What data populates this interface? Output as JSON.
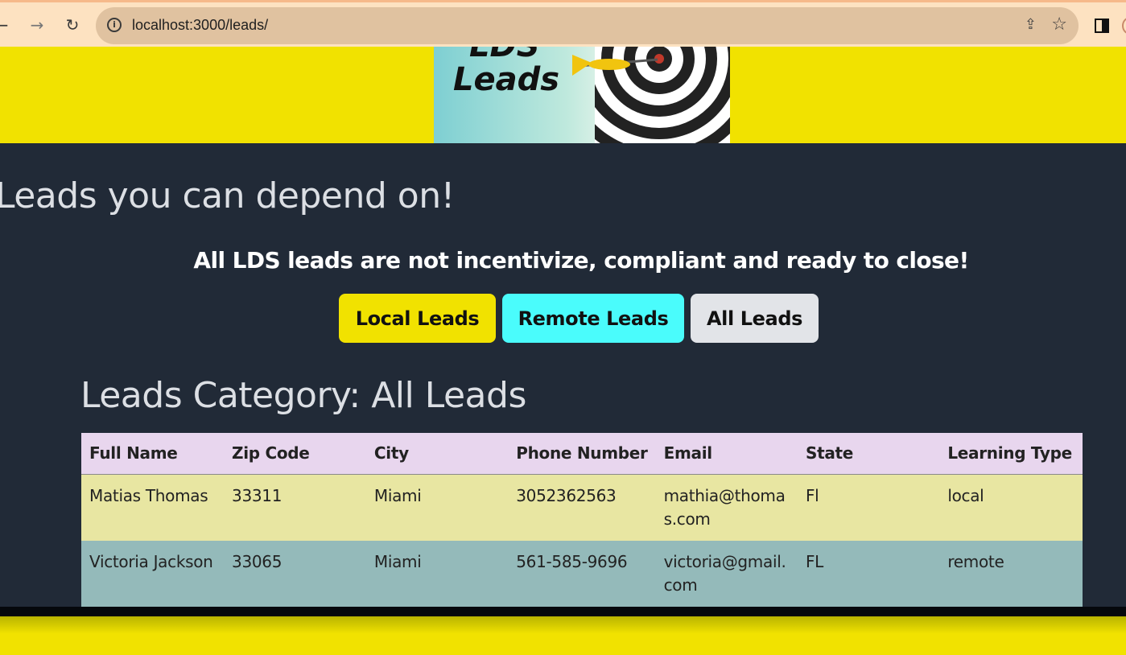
{
  "browser": {
    "url": "localhost:3000/leads/"
  },
  "header": {
    "logo_text": "Leads",
    "logo_text_top": "LDS"
  },
  "main": {
    "tagline": "Leads you can depend on!",
    "subtagline": "All LDS leads are not incentivize, compliant and ready to close!",
    "buttons": {
      "local": "Local Leads",
      "remote": "Remote Leads",
      "all": "All Leads"
    },
    "category_title": "Leads Category: All Leads"
  },
  "table": {
    "headers": [
      "Full Name",
      "Zip Code",
      "City",
      "Phone Number",
      "Email",
      "State",
      "Learning Type"
    ],
    "rows": [
      {
        "full_name": "Matias Thomas",
        "zip": "33311",
        "city": "Miami",
        "phone": "3052362563",
        "email": "mathia@thomas.com",
        "state": "Fl",
        "learning_type": "local"
      },
      {
        "full_name": "Victoria Jackson",
        "zip": "33065",
        "city": "Miami",
        "phone": "561-585-9696",
        "email": "victoria@gmail.com",
        "state": "FL",
        "learning_type": "remote"
      }
    ]
  },
  "colors": {
    "banner_yellow": "#f1e200",
    "page_bg": "#212a37",
    "remote_cyan": "#4afcfc",
    "header_row": "#e8d6ee",
    "row_a": "#e8e6a2",
    "row_b": "#94baba"
  }
}
